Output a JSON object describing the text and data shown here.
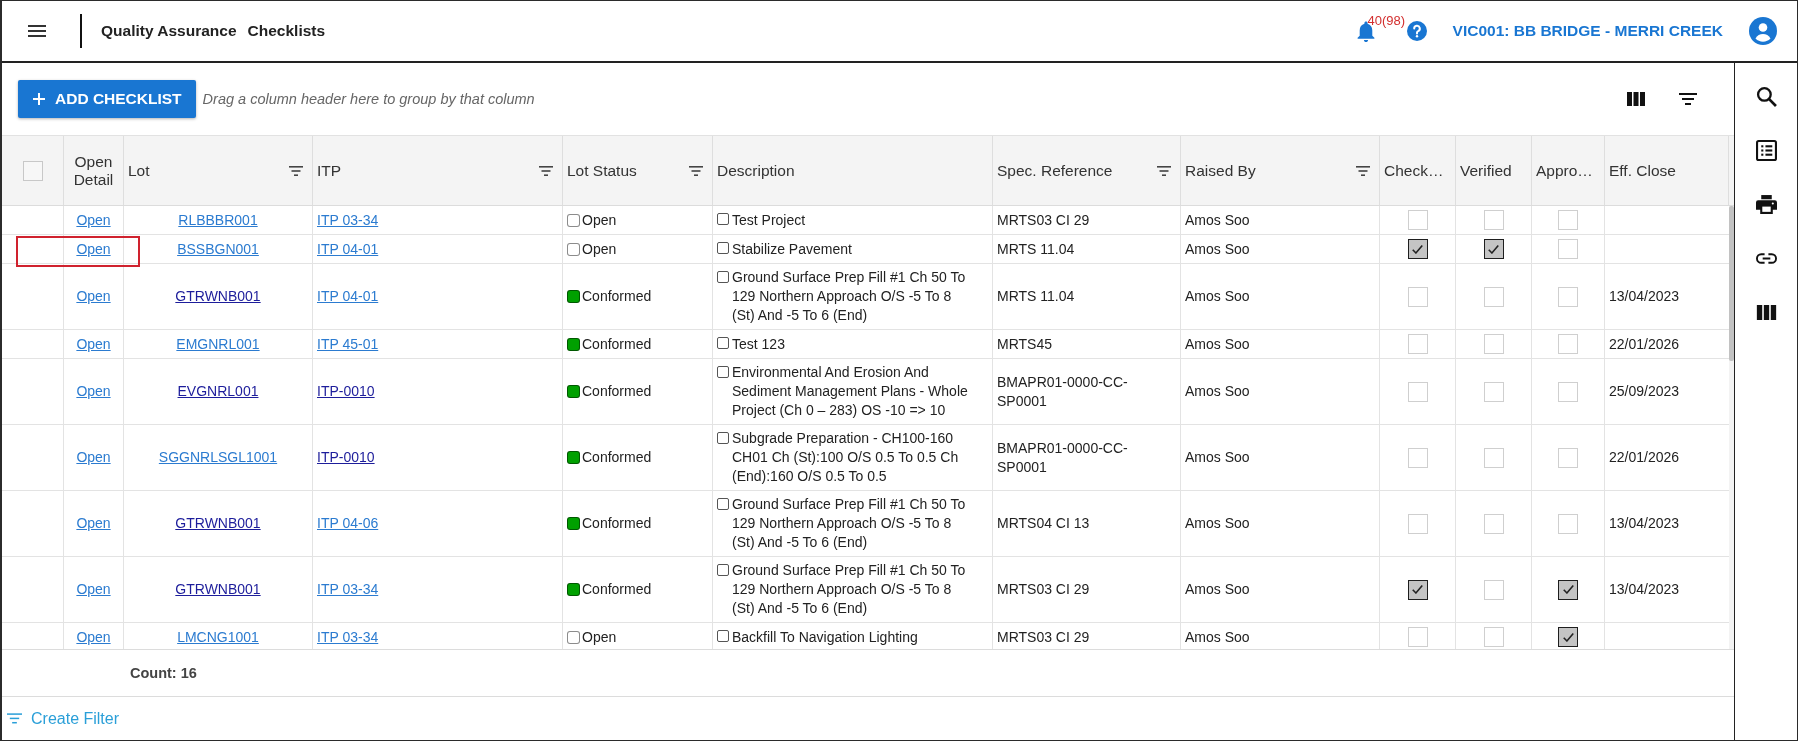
{
  "app_bar": {
    "title": "Quality Assurance",
    "page": "Checklists",
    "notification_count": "40(98)",
    "project": "VIC001: BB BRIDGE - MERRI CREEK"
  },
  "toolbar": {
    "add_button": "ADD CHECKLIST",
    "group_hint": "Drag a column header here to group by that column"
  },
  "table": {
    "select_all": {
      "checked": false
    },
    "columns": [
      {
        "label": "Open Detail",
        "filter": false
      },
      {
        "label": "Lot",
        "filter": true
      },
      {
        "label": "ITP",
        "filter": true
      },
      {
        "label": "Lot Status",
        "filter": true
      },
      {
        "label": "Description",
        "filter": false
      },
      {
        "label": "Spec. Reference",
        "filter": true
      },
      {
        "label": "Raised By",
        "filter": true
      },
      {
        "label": "Check…",
        "filter": false
      },
      {
        "label": "Verified",
        "filter": false
      },
      {
        "label": "Appro…",
        "filter": false
      },
      {
        "label": "Eff. Close",
        "filter": false
      }
    ],
    "rows": [
      {
        "open": "Open",
        "lot": {
          "text": "RLBBBR001",
          "visited": false
        },
        "itp": {
          "text": "ITP 03-34",
          "visited": false
        },
        "status": {
          "label": "Open",
          "color": "#ffffff"
        },
        "description": {
          "text": "Test Project",
          "checked": false
        },
        "spec_reference": "MRTS03 CI 29",
        "raised_by": "Amos Soo",
        "check": false,
        "verified": false,
        "approved": false,
        "highlighted": false
      },
      {
        "open": "Open",
        "lot": {
          "text": "BSSBGN001",
          "visited": false
        },
        "itp": {
          "text": "ITP 04-01",
          "visited": false
        },
        "status": {
          "label": "Open",
          "color": "#ffffff"
        },
        "description": {
          "text": "Stabilize Pavement",
          "checked": false
        },
        "spec_reference": "MRTS 11.04",
        "raised_by": "Amos Soo",
        "check": true,
        "verified": true,
        "approved": false,
        "highlighted": true
      },
      {
        "open": "Open",
        "lot": {
          "text": "GTRWNB001",
          "visited": true
        },
        "itp": {
          "text": "ITP 04-01",
          "visited": false
        },
        "status": {
          "label": "Conformed",
          "color": "#00a000"
        },
        "description": {
          "text": "Ground Surface Prep Fill #1 Ch 50 To 129 Northern Approach O/S -5 To 8 (St) And -5 To 6 (End)",
          "checked": false
        },
        "spec_reference": "MRTS 11.04",
        "raised_by": "Amos Soo",
        "check": false,
        "verified": false,
        "approved": false,
        "eff_close": "13/04/2023",
        "highlighted": false
      },
      {
        "open": "Open",
        "lot": {
          "text": "EMGNRL001",
          "visited": false
        },
        "itp": {
          "text": "ITP 45-01",
          "visited": false
        },
        "status": {
          "label": "Conformed",
          "color": "#00a000"
        },
        "description": {
          "text": "Test 123",
          "checked": false
        },
        "spec_reference": "MRTS45",
        "raised_by": "Amos Soo",
        "check": false,
        "verified": false,
        "approved": false,
        "eff_close": "22/01/2026",
        "highlighted": false
      },
      {
        "open": "Open",
        "lot": {
          "text": "EVGNRL001",
          "visited": true
        },
        "itp": {
          "text": "ITP-0010",
          "visited": true
        },
        "status": {
          "label": "Conformed",
          "color": "#00a000"
        },
        "description": {
          "text": "Environmental And Erosion And Sediment Management Plans - Whole Project (Ch 0 – 283) OS -10 => 10",
          "checked": false
        },
        "spec_reference": "BMAPR01-0000-CC-SP0001",
        "raised_by": "Amos Soo",
        "check": false,
        "verified": false,
        "approved": false,
        "eff_close": "25/09/2023",
        "highlighted": false
      },
      {
        "open": "Open",
        "lot": {
          "text": "SGGNRLSGL1001",
          "visited": false
        },
        "itp": {
          "text": "ITP-0010",
          "visited": true
        },
        "status": {
          "label": "Conformed",
          "color": "#00a000"
        },
        "description": {
          "text": "Subgrade Preparation - CH100-160 CH01 Ch (St):100 O/S 0.5 To 0.5 Ch (End):160 O/S 0.5 To 0.5",
          "checked": false
        },
        "spec_reference": "BMAPR01-0000-CC-SP0001",
        "raised_by": "Amos Soo",
        "check": false,
        "verified": false,
        "approved": false,
        "eff_close": "22/01/2026",
        "highlighted": false
      },
      {
        "open": "Open",
        "lot": {
          "text": "GTRWNB001",
          "visited": true
        },
        "itp": {
          "text": "ITP 04-06",
          "visited": false
        },
        "status": {
          "label": "Conformed",
          "color": "#00a000"
        },
        "description": {
          "text": "Ground Surface Prep Fill #1 Ch 50 To 129 Northern Approach O/S -5 To 8 (St) And -5 To 6 (End)",
          "checked": false
        },
        "spec_reference": "MRTS04 CI 13",
        "raised_by": "Amos Soo",
        "check": false,
        "verified": false,
        "approved": false,
        "eff_close": "13/04/2023",
        "highlighted": false
      },
      {
        "open": "Open",
        "lot": {
          "text": "GTRWNB001",
          "visited": true
        },
        "itp": {
          "text": "ITP 03-34",
          "visited": false
        },
        "status": {
          "label": "Conformed",
          "color": "#00a000"
        },
        "description": {
          "text": "Ground Surface Prep Fill #1 Ch 50 To 129 Northern Approach O/S -5 To 8 (St) And -5 To 6 (End)",
          "checked": false
        },
        "spec_reference": "MRTS03 CI 29",
        "raised_by": "Amos Soo",
        "check": true,
        "verified": false,
        "approved": true,
        "eff_close": "13/04/2023",
        "highlighted": false
      },
      {
        "open": "Open",
        "lot": {
          "text": "LMCNG1001",
          "visited": false
        },
        "itp": {
          "text": "ITP 03-34",
          "visited": false
        },
        "status": {
          "label": "Open",
          "color": "#ffffff"
        },
        "description": {
          "text": "Backfill To Navigation Lighting",
          "checked": false
        },
        "spec_reference": "MRTS03 CI 29",
        "raised_by": "Amos Soo",
        "check": false,
        "verified": false,
        "approved": true,
        "highlighted": false
      }
    ],
    "count": "Count: 16"
  },
  "create_filter": "Create Filter"
}
